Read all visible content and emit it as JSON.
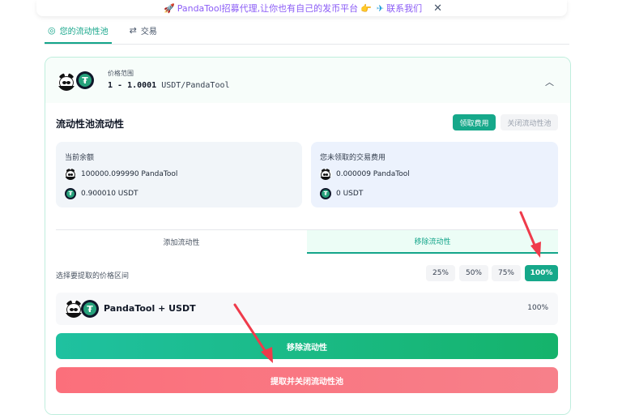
{
  "banner": {
    "rocket_icon": "rocket-icon",
    "text_main": "PandaTool招募代理,让你也有自己的发币平台",
    "hand_icon": "pointing-hand-icon",
    "telegram_icon": "telegram-icon",
    "contact": "联系我们",
    "close_glyph": "✕"
  },
  "tabs": [
    {
      "label": "您的流动性池",
      "icon": "pool-icon",
      "active": true
    },
    {
      "label": "交易",
      "icon": "swap-icon",
      "active": false
    }
  ],
  "position": {
    "range_label": "价格范围",
    "range_value": "1 - 1.0001",
    "pair": "USDT/PandaTool"
  },
  "liquidity": {
    "title": "流动性池流动性",
    "collect_fees_button": "领取费用",
    "close_pool_button": "关闭流动性池",
    "balance": {
      "label": "当前余额",
      "panda_amount": "100000.099990 PandaTool",
      "usdt_amount": "0.900010 USDT"
    },
    "unclaimed_fees": {
      "label": "您未领取的交易费用",
      "panda_amount": "0.000009 PandaTool",
      "usdt_amount": "0 USDT"
    }
  },
  "segment": {
    "add_label": "添加流动性",
    "remove_label": "移除流动性",
    "active": "remove"
  },
  "withdraw": {
    "pick_label": "选择要提取的价格区间",
    "percent_options": [
      "25%",
      "50%",
      "75%",
      "100%"
    ],
    "selected_percent": "100%",
    "pair_name": "PandaTool + USDT",
    "pair_percent": "100%",
    "remove_button": "移除流动性",
    "withdraw_close_button": "提取并关闭流动性池"
  },
  "colors": {
    "accent": "#16a88a",
    "danger": "#fb6f7b",
    "arrow": "#ef3b4b"
  }
}
